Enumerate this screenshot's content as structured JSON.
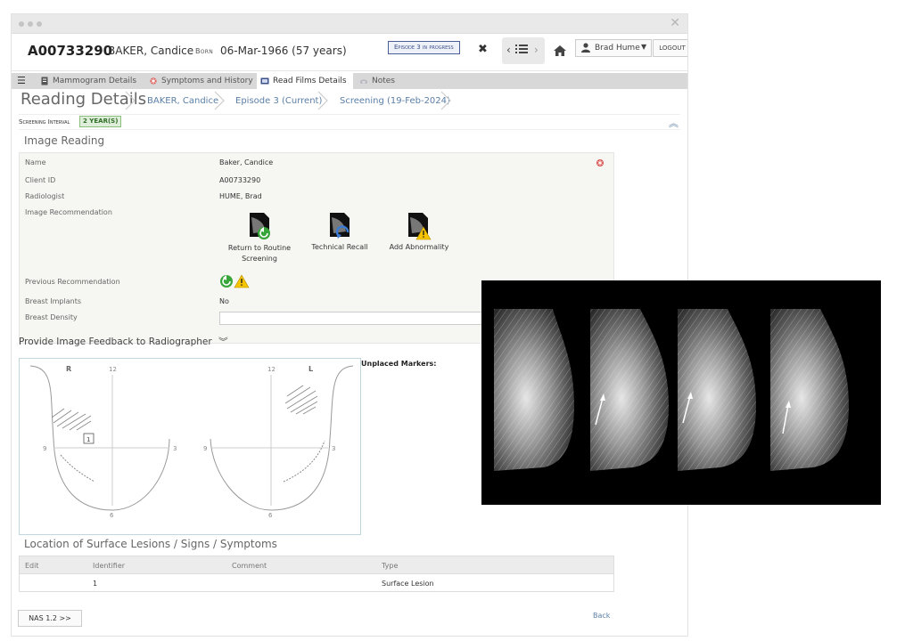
{
  "header": {
    "client_id": "A00733290",
    "client_name": "BAKER, Candice",
    "born_label": "Born",
    "born_value": "06-Mar-1966 (57 years)",
    "episode_badge": "Episode 3 in progress",
    "user_name": "Brad Hume",
    "logout_label": "LOGOUT"
  },
  "tabs": [
    {
      "label": "Mammogram Details",
      "icon": "document-icon"
    },
    {
      "label": "Symptoms and History",
      "icon": "asterisk-icon"
    },
    {
      "label": "Read Films Details",
      "icon": "film-icon",
      "active": true
    },
    {
      "label": "Notes",
      "icon": "notes-icon"
    }
  ],
  "breadcrumb": {
    "title": "Reading Details",
    "items": [
      "BAKER, Candice",
      "Episode 3 (Current)",
      "Screening (19-Feb-2024)"
    ]
  },
  "screening_interval": {
    "label": "Screening Interval",
    "value": "2 YEAR(S)"
  },
  "image_reading": {
    "section_title": "Image Reading",
    "name_label": "Name",
    "name_value": "Baker, Candice",
    "client_id_label": "Client ID",
    "client_id_value": "A00733290",
    "radiologist_label": "Radiologist",
    "radiologist_value": "HUME, Brad",
    "recommendation_label": "Image Recommendation",
    "recommendations": [
      {
        "label": "Return to Routine Screening",
        "icon": "return-routine-icon"
      },
      {
        "label": "Technical Recall",
        "icon": "technical-recall-icon"
      },
      {
        "label": "Add Abnormality",
        "icon": "add-abnormality-icon"
      }
    ],
    "previous_label": "Previous Recommendation",
    "implants_label": "Breast Implants",
    "implants_value": "No",
    "density_label": "Breast Density",
    "density_value": ""
  },
  "feedback": {
    "title": "Provide Image Feedback to Radiographer",
    "unplaced_label": "Unplaced Markers:",
    "right_label": "R",
    "left_label": "L",
    "clock_12": "12",
    "clock_9": "9",
    "clock_3": "3",
    "clock_6": "6",
    "marker_number": "1"
  },
  "lesions": {
    "title": "Location of Surface Lesions / Signs / Symptoms",
    "columns": [
      "Edit",
      "Identifier",
      "Comment",
      "Type"
    ],
    "rows": [
      {
        "edit": "",
        "identifier": "1",
        "comment": "",
        "type": "Surface Lesion"
      }
    ]
  },
  "footer": {
    "nas_label": "NAS 1.2 >>",
    "back_label": "Back"
  },
  "colors": {
    "link": "#5b7fa6",
    "episode_badge": "#3b4f8a",
    "interval_badge": "#2f6e24",
    "tab_bar": "#d8d8d8"
  }
}
